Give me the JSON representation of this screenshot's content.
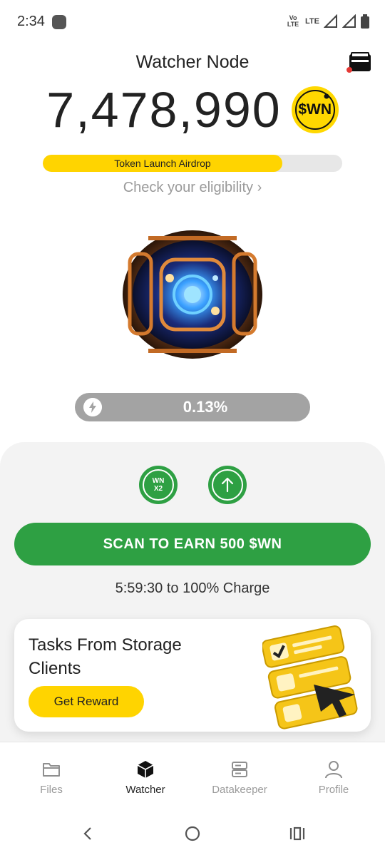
{
  "status_bar": {
    "time": "2:34",
    "volte": "Vo LTE",
    "lte": "LTE"
  },
  "header": {
    "title": "Watcher Node"
  },
  "balance": {
    "amount": "7,478,990",
    "token": "$WN"
  },
  "airdrop": {
    "label": "Token Launch Airdrop",
    "progress_fraction": 0.8,
    "link": "Check your eligibility ›"
  },
  "charge": {
    "percent_label": "0.13%"
  },
  "boosts": {
    "multiplier_line1": "WN",
    "multiplier_line2": "X2"
  },
  "scan": {
    "button_label": "SCAN TO EARN 500 $WN",
    "timer": "5:59:30 to 100% Charge"
  },
  "tasks": {
    "title": "Tasks From Storage Clients",
    "button_label": "Get Reward"
  },
  "nav": {
    "items": [
      {
        "label": "Files",
        "icon": "folder-icon"
      },
      {
        "label": "Watcher",
        "icon": "cube-icon",
        "active": true
      },
      {
        "label": "Datakeeper",
        "icon": "server-icon"
      },
      {
        "label": "Profile",
        "icon": "person-icon"
      }
    ]
  },
  "colors": {
    "green": "#2ea043",
    "yellow": "#ffd400",
    "gray": "#a3a3a3"
  }
}
